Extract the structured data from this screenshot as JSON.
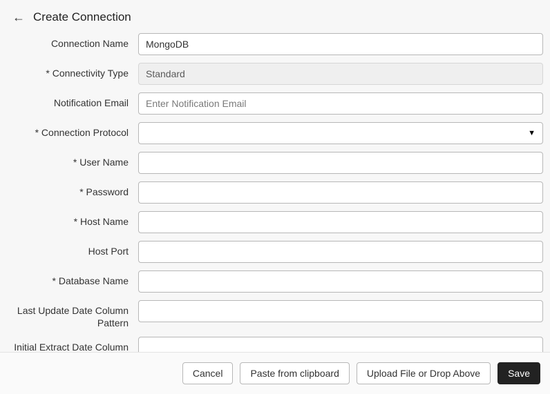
{
  "header": {
    "title": "Create Connection"
  },
  "fields": {
    "connection_name": {
      "label": "Connection Name",
      "value": "MongoDB",
      "required": false
    },
    "connectivity_type": {
      "label": "Connectivity Type",
      "value": "Standard",
      "required": true
    },
    "notification_email": {
      "label": "Notification Email",
      "placeholder": "Enter Notification Email",
      "required": false
    },
    "connection_protocol": {
      "label": "Connection Protocol",
      "value": "",
      "required": true
    },
    "user_name": {
      "label": "User Name",
      "value": "",
      "required": true
    },
    "password": {
      "label": "Password",
      "value": "",
      "required": true
    },
    "host_name": {
      "label": "Host Name",
      "value": "",
      "required": true
    },
    "host_port": {
      "label": "Host Port",
      "value": "",
      "required": false
    },
    "database_name": {
      "label": "Database Name",
      "value": "",
      "required": true
    },
    "last_update_pattern": {
      "label": "Last Update Date Column Pattern",
      "value": "",
      "required": false
    },
    "initial_extract_pattern": {
      "label": "Initial Extract Date Column Pattern",
      "value": "",
      "required": false
    }
  },
  "footer": {
    "cancel": "Cancel",
    "paste": "Paste from clipboard",
    "upload": "Upload File or Drop Above",
    "save": "Save"
  }
}
